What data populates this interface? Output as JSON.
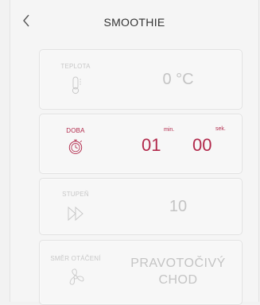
{
  "header": {
    "back_icon": "chevron-left-icon",
    "title": "SMOOTHIE"
  },
  "cards": {
    "temperature": {
      "label": "TEPLOTA",
      "icon": "thermometer-icon",
      "value": "0 °C"
    },
    "time": {
      "label": "DOBA",
      "icon": "stopwatch-icon",
      "minutes": "01",
      "min_unit": "min.",
      "seconds": "00",
      "sec_unit": "sek."
    },
    "speed": {
      "label": "STUPEŇ",
      "icon": "fast-forward-icon",
      "value": "10"
    },
    "direction": {
      "label": "SMĚR OTÁČENÍ",
      "icon": "fan-icon",
      "value_line1": "PRAVOTOČIVÝ",
      "value_line2": "CHOD"
    }
  },
  "colors": {
    "accent": "#b22a4c",
    "inactive": "#c4c4c4"
  }
}
